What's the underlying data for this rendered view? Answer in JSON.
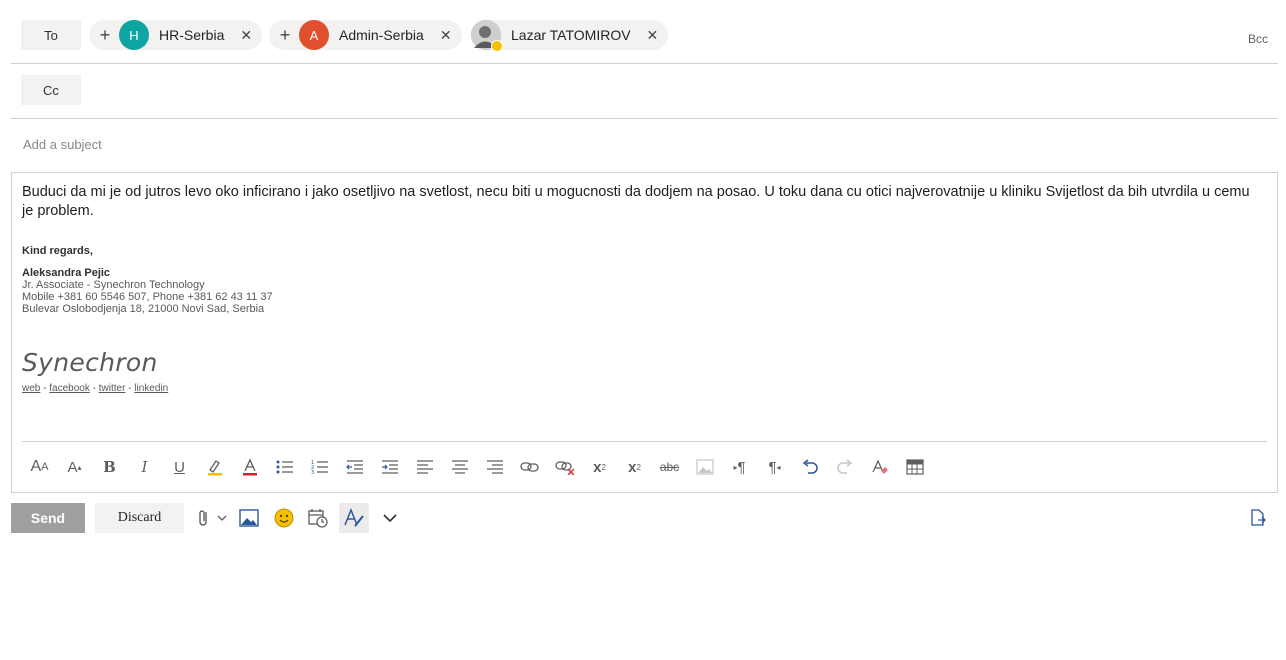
{
  "to_row": {
    "label": "To",
    "bcc_label": "Bcc",
    "recipients": [
      {
        "initial": "H",
        "name": "HR-Serbia",
        "color": "#0ea5a3"
      },
      {
        "initial": "A",
        "name": "Admin-Serbia",
        "color": "#e0502d"
      },
      {
        "initial": "",
        "name": "Lazar TATOMIROV",
        "color": "#888888"
      }
    ]
  },
  "cc_row": {
    "label": "Cc"
  },
  "subject": {
    "placeholder": "Add a subject",
    "value": ""
  },
  "body": {
    "text": "Buduci da mi je od jutros levo oko inficirano i jako osetljivo na svetlost, necu biti u mogucnosti da dodjem na posao. U toku dana cu otici najverovatnije u kliniku Svijetlost da bih utvrdila u cemu je problem.",
    "signature": {
      "regards": "Kind regards,",
      "name": "Aleksandra Pejic",
      "title": "Jr. Associate - Synechron Technology",
      "phones": "Mobile +381 60 5546 507, Phone +381 62 43 11 37",
      "address": "Bulevar Oslobodjenja 18, 21000 Novi Sad, Serbia",
      "logo_text": "Synechron",
      "links": [
        "web",
        "facebook",
        "twitter",
        "linkedin"
      ]
    }
  },
  "format_toolbar": {
    "tools": [
      "font-size",
      "grow-font",
      "bold",
      "italic",
      "underline",
      "highlight",
      "font-color",
      "bullets",
      "numbering",
      "decrease-indent",
      "increase-indent",
      "align-left",
      "align-center",
      "align-right",
      "insert-link",
      "remove-link",
      "superscript",
      "subscript",
      "strikethrough",
      "insert-image",
      "ltr",
      "rtl",
      "undo",
      "redo",
      "clear-formatting",
      "insert-table"
    ]
  },
  "actions": {
    "send_label": "Send",
    "discard_label": "Discard"
  },
  "colors": {
    "accent": "#0078d4",
    "send_disabled": "#a19f9d",
    "spell_underline": "#d13438"
  }
}
